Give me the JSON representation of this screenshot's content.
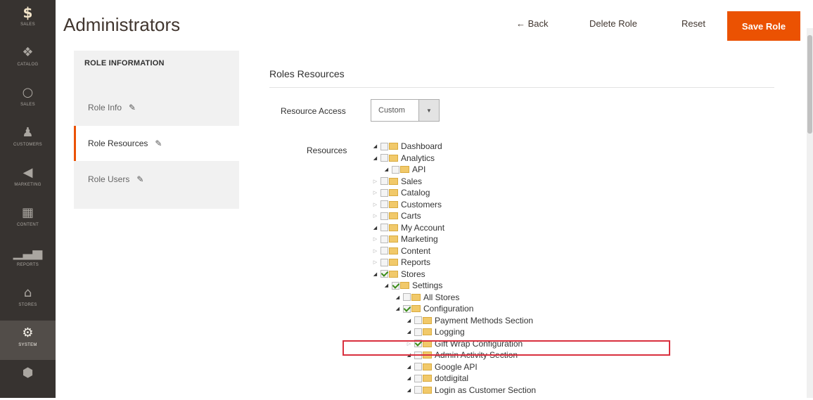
{
  "nav": [
    {
      "icon": "$",
      "label": "Sales",
      "key": "sales",
      "logo": true
    },
    {
      "icon": "❖",
      "label": "Catalog",
      "key": "catalog"
    },
    {
      "icon": "○",
      "label": "Sales",
      "key": "sales2"
    },
    {
      "icon": "♟",
      "label": "Customers",
      "key": "customers"
    },
    {
      "icon": "◀",
      "label": "Marketing",
      "key": "marketing"
    },
    {
      "icon": "▦",
      "label": "Content",
      "key": "content"
    },
    {
      "icon": "▁▃▅",
      "label": "Reports",
      "key": "reports"
    },
    {
      "icon": "⌂",
      "label": "Stores",
      "key": "stores"
    },
    {
      "icon": "⚙",
      "label": "System",
      "key": "system",
      "active": true
    },
    {
      "icon": "⬢",
      "label": "",
      "key": "extensions"
    }
  ],
  "header": {
    "title": "Administrators",
    "back": "← Back",
    "delete": "Delete Role",
    "reset": "Reset",
    "save": "Save Role"
  },
  "tabs": {
    "heading": "ROLE INFORMATION",
    "items": [
      {
        "label": "Role Info",
        "active": false
      },
      {
        "label": "Role Resources",
        "active": true
      },
      {
        "label": "Role Users",
        "active": false
      }
    ]
  },
  "main": {
    "section_title": "Roles Resources",
    "resource_access_label": "Resource Access",
    "resource_access_value": "Custom",
    "resources_label": "Resources"
  },
  "tree": [
    {
      "label": "Dashboard",
      "level": 0,
      "open": true,
      "checked": false
    },
    {
      "label": "Analytics",
      "level": 0,
      "open": true,
      "checked": false
    },
    {
      "label": "API",
      "level": 1,
      "open": true,
      "checked": false
    },
    {
      "label": "Sales",
      "level": 0,
      "open": false,
      "checked": false
    },
    {
      "label": "Catalog",
      "level": 0,
      "open": false,
      "checked": false
    },
    {
      "label": "Customers",
      "level": 0,
      "open": false,
      "checked": false
    },
    {
      "label": "Carts",
      "level": 0,
      "open": false,
      "checked": false
    },
    {
      "label": "My Account",
      "level": 0,
      "open": true,
      "checked": false
    },
    {
      "label": "Marketing",
      "level": 0,
      "open": false,
      "checked": false
    },
    {
      "label": "Content",
      "level": 0,
      "open": false,
      "checked": false
    },
    {
      "label": "Reports",
      "level": 0,
      "open": false,
      "checked": false
    },
    {
      "label": "Stores",
      "level": 0,
      "open": true,
      "checked": true
    },
    {
      "label": "Settings",
      "level": 1,
      "open": true,
      "checked": true
    },
    {
      "label": "All Stores",
      "level": 2,
      "open": true,
      "checked": false
    },
    {
      "label": "Configuration",
      "level": 2,
      "open": true,
      "checked": true
    },
    {
      "label": "Payment Methods Section",
      "level": 3,
      "open": true,
      "checked": false
    },
    {
      "label": "Logging",
      "level": 3,
      "open": true,
      "checked": false
    },
    {
      "label": "Gift Wrap Configuration",
      "level": 3,
      "open": false,
      "checked": true
    },
    {
      "label": "Admin Activity Section",
      "level": 3,
      "open": true,
      "checked": false
    },
    {
      "label": "Google API",
      "level": 3,
      "open": true,
      "checked": false
    },
    {
      "label": "dotdigital",
      "level": 3,
      "open": true,
      "checked": false
    },
    {
      "label": "Login as Customer Section",
      "level": 3,
      "open": true,
      "checked": false
    }
  ]
}
